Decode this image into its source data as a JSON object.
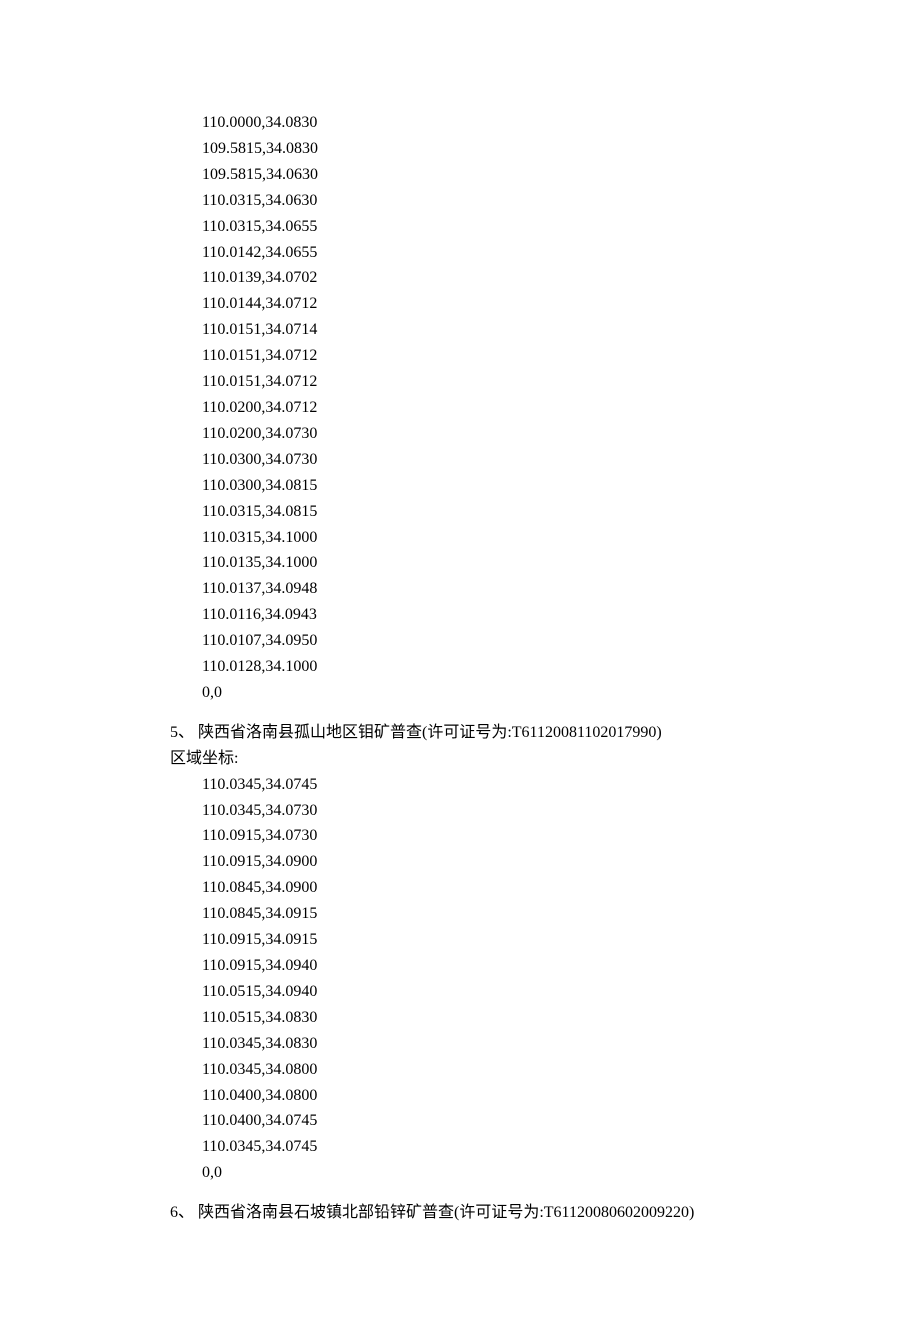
{
  "block1_coords": [
    "110.0000,34.0830",
    "109.5815,34.0830",
    "109.5815,34.0630",
    "110.0315,34.0630",
    "110.0315,34.0655",
    "110.0142,34.0655",
    "110.0139,34.0702",
    "110.0144,34.0712",
    "110.0151,34.0714",
    "110.0151,34.0712",
    "110.0151,34.0712",
    "110.0200,34.0712",
    "110.0200,34.0730",
    "110.0300,34.0730",
    "110.0300,34.0815",
    "110.0315,34.0815",
    "110.0315,34.1000",
    "110.0135,34.1000",
    "110.0137,34.0948",
    "110.0116,34.0943",
    "110.0107,34.0950",
    "110.0128,34.1000",
    "0,0"
  ],
  "section5": {
    "heading": "5、  陕西省洛南县孤山地区钼矿普查(许可证号为:T61120081102017990)",
    "area_label": "区域坐标:",
    "coords": [
      "110.0345,34.0745",
      "110.0345,34.0730",
      "110.0915,34.0730",
      "110.0915,34.0900",
      "110.0845,34.0900",
      "110.0845,34.0915",
      "110.0915,34.0915",
      "110.0915,34.0940",
      "110.0515,34.0940",
      "110.0515,34.0830",
      "110.0345,34.0830",
      "110.0345,34.0800",
      "110.0400,34.0800",
      "110.0400,34.0745",
      "110.0345,34.0745",
      "0,0"
    ]
  },
  "section6": {
    "heading": "6、  陕西省洛南县石坡镇北部铅锌矿普查(许可证号为:T61120080602009220)"
  }
}
